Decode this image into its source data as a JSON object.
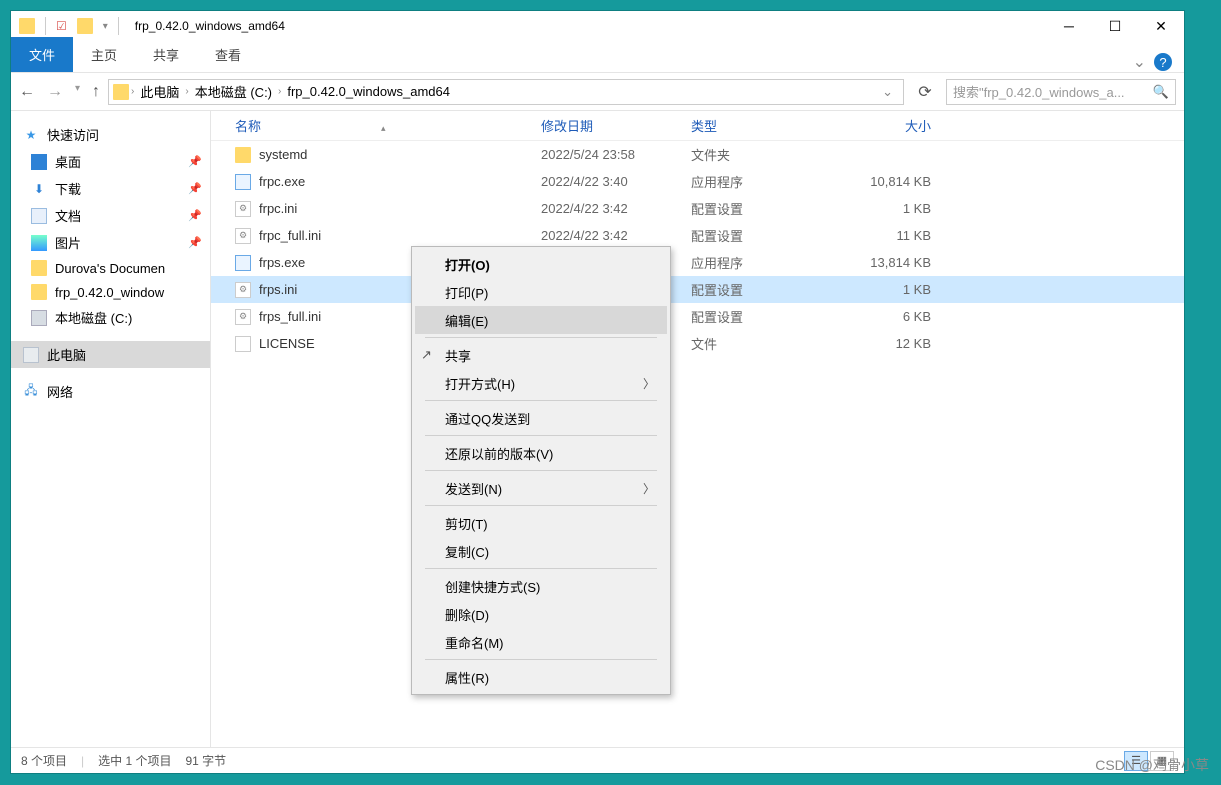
{
  "title": "frp_0.42.0_windows_amd64",
  "ribbon": {
    "file": "文件",
    "home": "主页",
    "share": "共享",
    "view": "查看"
  },
  "nav": {
    "crumb_root": "此电脑",
    "crumb_drive": "本地磁盘 (C:)",
    "crumb_folder": "frp_0.42.0_windows_amd64"
  },
  "search": {
    "placeholder": "搜索\"frp_0.42.0_windows_a..."
  },
  "sidebar": {
    "quick": "快速访问",
    "desktop": "桌面",
    "downloads": "下载",
    "documents": "文档",
    "pictures": "图片",
    "durova": "Durova's Documen",
    "frp": "frp_0.42.0_window",
    "cdrive": "本地磁盘 (C:)",
    "thispc": "此电脑",
    "network": "网络"
  },
  "columns": {
    "name": "名称",
    "date": "修改日期",
    "type": "类型",
    "size": "大小"
  },
  "files": [
    {
      "name": "systemd",
      "date": "2022/5/24 23:58",
      "type": "文件夹",
      "size": "",
      "icon": "folder"
    },
    {
      "name": "frpc.exe",
      "date": "2022/4/22 3:40",
      "type": "应用程序",
      "size": "10,814 KB",
      "icon": "exe"
    },
    {
      "name": "frpc.ini",
      "date": "2022/4/22 3:42",
      "type": "配置设置",
      "size": "1 KB",
      "icon": "ini"
    },
    {
      "name": "frpc_full.ini",
      "date": "2022/4/22 3:42",
      "type": "配置设置",
      "size": "11 KB",
      "icon": "ini"
    },
    {
      "name": "frps.exe",
      "date": "2022/4/22 3:40",
      "type": "应用程序",
      "size": "13,814 KB",
      "icon": "exe"
    },
    {
      "name": "frps.ini",
      "date": "",
      "type": "配置设置",
      "size": "1 KB",
      "icon": "ini",
      "selected": true
    },
    {
      "name": "frps_full.ini",
      "date": "",
      "type": "配置设置",
      "size": "6 KB",
      "icon": "ini"
    },
    {
      "name": "LICENSE",
      "date": "",
      "type": "文件",
      "size": "12 KB",
      "icon": "file"
    }
  ],
  "context": {
    "open": "打开(O)",
    "print": "打印(P)",
    "edit": "编辑(E)",
    "share": "共享",
    "openwith": "打开方式(H)",
    "qq": "通过QQ发送到",
    "restore": "还原以前的版本(V)",
    "sendto": "发送到(N)",
    "cut": "剪切(T)",
    "copy": "复制(C)",
    "shortcut": "创建快捷方式(S)",
    "delete": "删除(D)",
    "rename": "重命名(M)",
    "props": "属性(R)"
  },
  "status": {
    "items": "8 个项目",
    "selected": "选中 1 个项目",
    "bytes": "91 字节"
  },
  "watermark": "CSDN @鸡骨小草"
}
